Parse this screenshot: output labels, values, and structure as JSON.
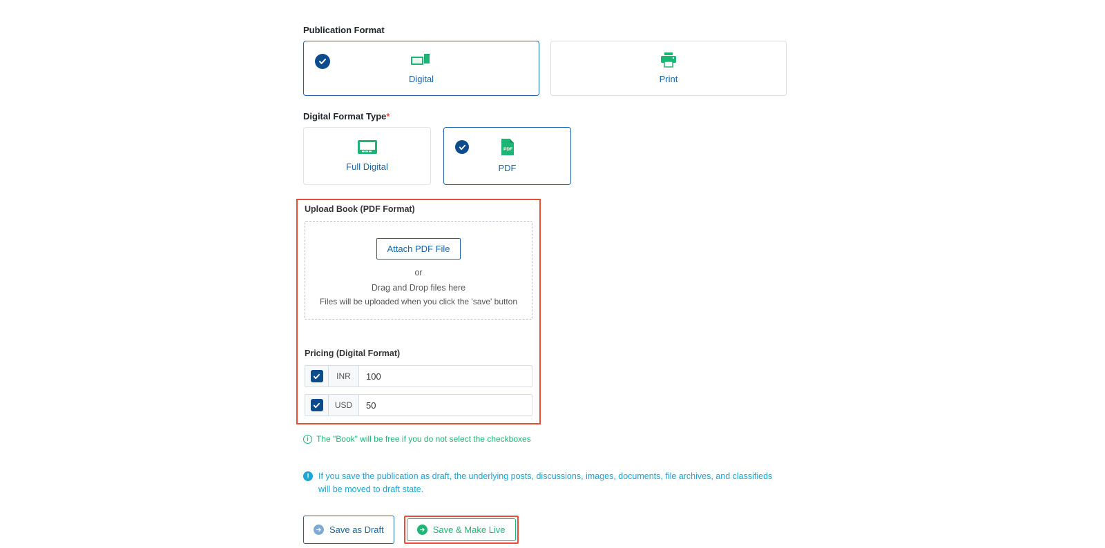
{
  "publicationFormat": {
    "label": "Publication Format",
    "options": [
      {
        "label": "Digital",
        "selected": true
      },
      {
        "label": "Print",
        "selected": false
      }
    ]
  },
  "digitalFormatType": {
    "label": "Digital Format Type",
    "options": [
      {
        "label": "Full Digital",
        "selected": false
      },
      {
        "label": "PDF",
        "selected": true
      }
    ]
  },
  "upload": {
    "sectionLabel": "Upload Book (PDF Format)",
    "attachButton": "Attach PDF File",
    "orText": "or",
    "dragText": "Drag and Drop files here",
    "noteText": "Files will be uploaded when you click the 'save' button"
  },
  "pricing": {
    "label": "Pricing (Digital Format)",
    "rows": [
      {
        "currency": "INR",
        "value": "100",
        "checked": true
      },
      {
        "currency": "USD",
        "value": "50",
        "checked": true
      }
    ],
    "freeHint": "The \"Book\" will be free if you do not select the checkboxes"
  },
  "draftWarning": "If you save the publication as draft, the underlying posts, discussions, images, documents, file archives, and classifieds will be moved to draft state.",
  "buttons": {
    "saveDraft": "Save as Draft",
    "saveLive": "Save & Make Live"
  }
}
